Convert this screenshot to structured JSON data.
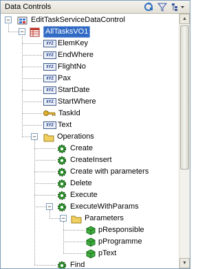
{
  "panel": {
    "title": "Data Controls",
    "toolbar_icons": [
      "refresh-icon",
      "filter-icon",
      "tree-options-icon"
    ]
  },
  "tree": {
    "root": {
      "label": "EditTaskServiceDataControl",
      "icon": "data-control-icon"
    },
    "vo": {
      "label": "AllTasksVO1",
      "icon": "collection-icon"
    },
    "attributes": [
      {
        "label": "ElemKey",
        "icon": "xyz-attribute-icon"
      },
      {
        "label": "EndWhere",
        "icon": "xyz-attribute-icon"
      },
      {
        "label": "FlightNo",
        "icon": "xyz-attribute-icon"
      },
      {
        "label": "Pax",
        "icon": "xyz-attribute-icon"
      },
      {
        "label": "StartDate",
        "icon": "xyz-attribute-icon"
      },
      {
        "label": "StartWhere",
        "icon": "xyz-attribute-icon"
      },
      {
        "label": "TaskId",
        "icon": "key-attribute-icon"
      },
      {
        "label": "Text",
        "icon": "xyz-attribute-icon"
      }
    ],
    "operations": {
      "label": "Operations",
      "items": [
        {
          "label": "Create"
        },
        {
          "label": "CreateInsert"
        },
        {
          "label": "Create with parameters"
        },
        {
          "label": "Delete"
        },
        {
          "label": "Execute"
        },
        {
          "label": "ExecuteWithParams"
        }
      ],
      "parameters": {
        "label": "Parameters",
        "items": [
          {
            "label": "pResponsible"
          },
          {
            "label": "pProgramme"
          },
          {
            "label": "pText"
          }
        ]
      },
      "after": [
        {
          "label": "Find"
        }
      ]
    },
    "xyz_text": "XYZ"
  },
  "colors": {
    "selection": "#316ac5",
    "gear": "#2e9a2e",
    "folder": "#f0d060"
  }
}
